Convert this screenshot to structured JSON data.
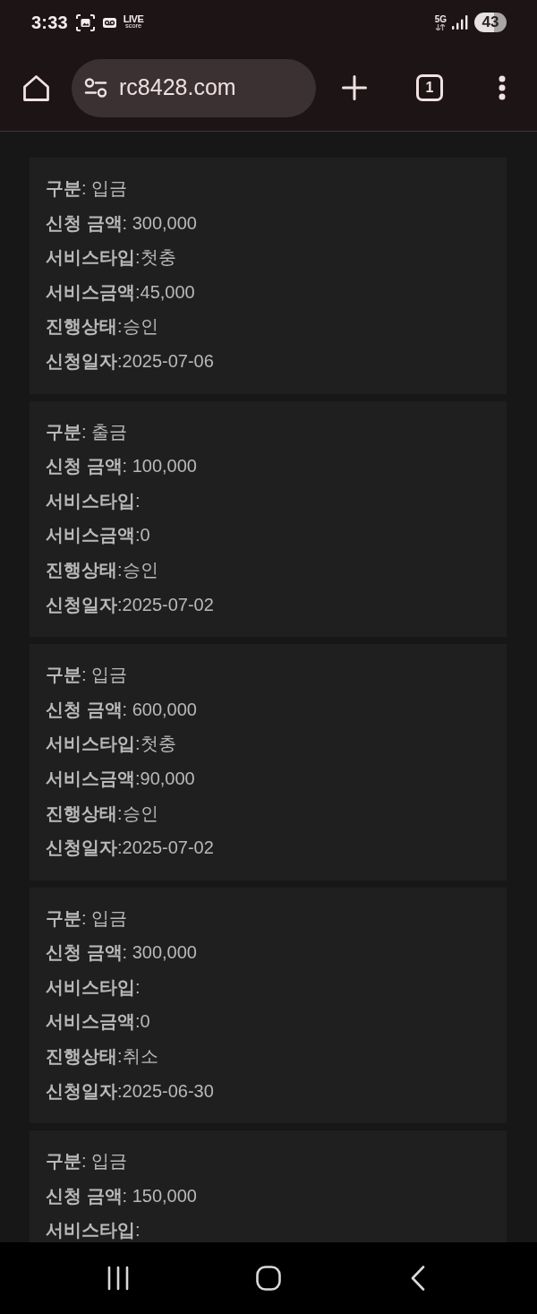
{
  "status_bar": {
    "time": "3:33",
    "app_logo": {
      "line_1": "LIVE",
      "line_2": "score"
    },
    "network": "5G",
    "battery": "43"
  },
  "browser_toolbar": {
    "url": "rc8428.com",
    "tab_count": "1"
  },
  "records": [
    {
      "lines": [
        "**구분**: 입금",
        "**신청 금액**: 300,000",
        "**서비스타입**:첫충",
        "**서비스금액**:45,000",
        "**진행상태**:승인",
        "**신청일자**:2025-07-06"
      ]
    },
    {
      "lines": [
        "**구분**: 출금",
        "**신청 금액**: 100,000",
        "**서비스타입**:",
        "**서비스금액**:0",
        "**진행상태**:승인",
        "**신청일자**:2025-07-02"
      ]
    },
    {
      "lines": [
        "**구분**: 입금",
        "**신청 금액**: 600,000",
        "**서비스타입**:첫충",
        "**서비스금액**:90,000",
        "**진행상태**:승인",
        "**신청일자**:2025-07-02"
      ]
    },
    {
      "lines": [
        "**구분**: 입금",
        "**신청 금액**: 300,000",
        "**서비스타입**:",
        "**서비스금액**:0",
        "**진행상태**:취소",
        "**신청일자**:2025-06-30"
      ]
    },
    {
      "lines": [
        "**구분**: 입금",
        "**신청 금액**: 150,000",
        "**서비스타입**:"
      ]
    }
  ]
}
